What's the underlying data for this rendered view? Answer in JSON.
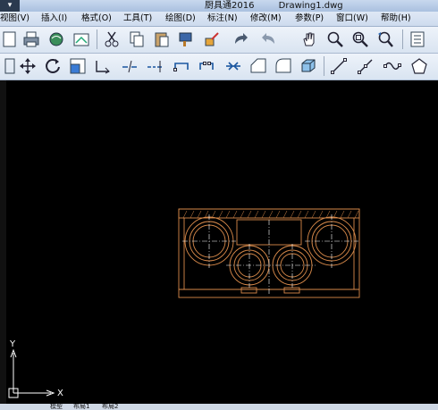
{
  "titlebar": {
    "app_name": "厨具通2016",
    "file_name": "Drawing1.dwg",
    "app_button_icon": "app-menu-icon"
  },
  "menu": [
    {
      "label": "视图(V)"
    },
    {
      "label": "插入(I)"
    },
    {
      "label": "格式(O)"
    },
    {
      "label": "工具(T)"
    },
    {
      "label": "绘图(D)"
    },
    {
      "label": "标注(N)"
    },
    {
      "label": "修改(M)"
    },
    {
      "label": "参数(P)"
    },
    {
      "label": "窗口(W)"
    },
    {
      "label": "帮助(H)"
    }
  ],
  "toolbar1": [
    "new-file-icon",
    "print-icon",
    "plot-preview-icon",
    "publish-icon",
    "cut-icon",
    "copy-icon",
    "paste-icon",
    "match-properties-icon",
    "block-editor-icon",
    "redo-icon",
    "undo-icon",
    "pan-icon",
    "zoom-realtime-icon",
    "zoom-window-icon",
    "zoom-previous-icon",
    "properties-icon"
  ],
  "toolbar2": [
    "grip-icon",
    "move-icon",
    "rotate-icon",
    "scale-icon",
    "stretch-icon",
    "trim-icon",
    "extend-icon",
    "break-at-point-icon",
    "break-icon",
    "join-icon",
    "chamfer-icon",
    "fillet-icon",
    "3d-box-icon",
    "line-icon",
    "polyline-icon",
    "spline-icon",
    "polygon-icon"
  ],
  "ucs": {
    "x_label": "X",
    "y_label": "Y"
  },
  "layout_tabs": [
    "模型",
    "布局1",
    "布局2"
  ],
  "colors": {
    "canvas": "#000000",
    "drawing_lines": "#d98a4a",
    "center_lines": "#ffffff",
    "ui_bar": "#dbe5f2"
  }
}
